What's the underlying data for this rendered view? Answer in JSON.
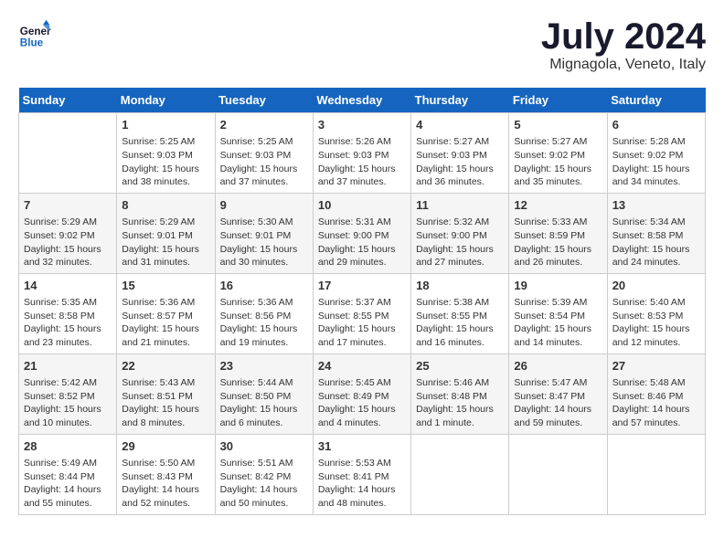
{
  "logo": {
    "line1": "General",
    "line2": "Blue"
  },
  "title": "July 2024",
  "location": "Mignagola, Veneto, Italy",
  "headers": [
    "Sunday",
    "Monday",
    "Tuesday",
    "Wednesday",
    "Thursday",
    "Friday",
    "Saturday"
  ],
  "weeks": [
    [
      {
        "day": "",
        "info": ""
      },
      {
        "day": "1",
        "info": "Sunrise: 5:25 AM\nSunset: 9:03 PM\nDaylight: 15 hours\nand 38 minutes."
      },
      {
        "day": "2",
        "info": "Sunrise: 5:25 AM\nSunset: 9:03 PM\nDaylight: 15 hours\nand 37 minutes."
      },
      {
        "day": "3",
        "info": "Sunrise: 5:26 AM\nSunset: 9:03 PM\nDaylight: 15 hours\nand 37 minutes."
      },
      {
        "day": "4",
        "info": "Sunrise: 5:27 AM\nSunset: 9:03 PM\nDaylight: 15 hours\nand 36 minutes."
      },
      {
        "day": "5",
        "info": "Sunrise: 5:27 AM\nSunset: 9:02 PM\nDaylight: 15 hours\nand 35 minutes."
      },
      {
        "day": "6",
        "info": "Sunrise: 5:28 AM\nSunset: 9:02 PM\nDaylight: 15 hours\nand 34 minutes."
      }
    ],
    [
      {
        "day": "7",
        "info": "Sunrise: 5:29 AM\nSunset: 9:02 PM\nDaylight: 15 hours\nand 32 minutes."
      },
      {
        "day": "8",
        "info": "Sunrise: 5:29 AM\nSunset: 9:01 PM\nDaylight: 15 hours\nand 31 minutes."
      },
      {
        "day": "9",
        "info": "Sunrise: 5:30 AM\nSunset: 9:01 PM\nDaylight: 15 hours\nand 30 minutes."
      },
      {
        "day": "10",
        "info": "Sunrise: 5:31 AM\nSunset: 9:00 PM\nDaylight: 15 hours\nand 29 minutes."
      },
      {
        "day": "11",
        "info": "Sunrise: 5:32 AM\nSunset: 9:00 PM\nDaylight: 15 hours\nand 27 minutes."
      },
      {
        "day": "12",
        "info": "Sunrise: 5:33 AM\nSunset: 8:59 PM\nDaylight: 15 hours\nand 26 minutes."
      },
      {
        "day": "13",
        "info": "Sunrise: 5:34 AM\nSunset: 8:58 PM\nDaylight: 15 hours\nand 24 minutes."
      }
    ],
    [
      {
        "day": "14",
        "info": "Sunrise: 5:35 AM\nSunset: 8:58 PM\nDaylight: 15 hours\nand 23 minutes."
      },
      {
        "day": "15",
        "info": "Sunrise: 5:36 AM\nSunset: 8:57 PM\nDaylight: 15 hours\nand 21 minutes."
      },
      {
        "day": "16",
        "info": "Sunrise: 5:36 AM\nSunset: 8:56 PM\nDaylight: 15 hours\nand 19 minutes."
      },
      {
        "day": "17",
        "info": "Sunrise: 5:37 AM\nSunset: 8:55 PM\nDaylight: 15 hours\nand 17 minutes."
      },
      {
        "day": "18",
        "info": "Sunrise: 5:38 AM\nSunset: 8:55 PM\nDaylight: 15 hours\nand 16 minutes."
      },
      {
        "day": "19",
        "info": "Sunrise: 5:39 AM\nSunset: 8:54 PM\nDaylight: 15 hours\nand 14 minutes."
      },
      {
        "day": "20",
        "info": "Sunrise: 5:40 AM\nSunset: 8:53 PM\nDaylight: 15 hours\nand 12 minutes."
      }
    ],
    [
      {
        "day": "21",
        "info": "Sunrise: 5:42 AM\nSunset: 8:52 PM\nDaylight: 15 hours\nand 10 minutes."
      },
      {
        "day": "22",
        "info": "Sunrise: 5:43 AM\nSunset: 8:51 PM\nDaylight: 15 hours\nand 8 minutes."
      },
      {
        "day": "23",
        "info": "Sunrise: 5:44 AM\nSunset: 8:50 PM\nDaylight: 15 hours\nand 6 minutes."
      },
      {
        "day": "24",
        "info": "Sunrise: 5:45 AM\nSunset: 8:49 PM\nDaylight: 15 hours\nand 4 minutes."
      },
      {
        "day": "25",
        "info": "Sunrise: 5:46 AM\nSunset: 8:48 PM\nDaylight: 15 hours\nand 1 minute."
      },
      {
        "day": "26",
        "info": "Sunrise: 5:47 AM\nSunset: 8:47 PM\nDaylight: 14 hours\nand 59 minutes."
      },
      {
        "day": "27",
        "info": "Sunrise: 5:48 AM\nSunset: 8:46 PM\nDaylight: 14 hours\nand 57 minutes."
      }
    ],
    [
      {
        "day": "28",
        "info": "Sunrise: 5:49 AM\nSunset: 8:44 PM\nDaylight: 14 hours\nand 55 minutes."
      },
      {
        "day": "29",
        "info": "Sunrise: 5:50 AM\nSunset: 8:43 PM\nDaylight: 14 hours\nand 52 minutes."
      },
      {
        "day": "30",
        "info": "Sunrise: 5:51 AM\nSunset: 8:42 PM\nDaylight: 14 hours\nand 50 minutes."
      },
      {
        "day": "31",
        "info": "Sunrise: 5:53 AM\nSunset: 8:41 PM\nDaylight: 14 hours\nand 48 minutes."
      },
      {
        "day": "",
        "info": ""
      },
      {
        "day": "",
        "info": ""
      },
      {
        "day": "",
        "info": ""
      }
    ]
  ]
}
